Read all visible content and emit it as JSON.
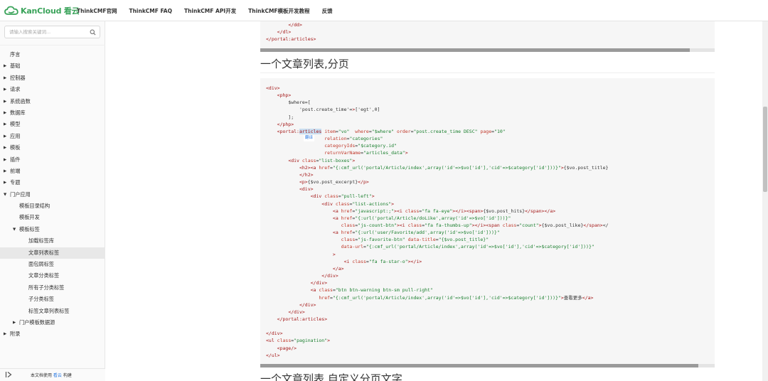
{
  "header": {
    "brand": "KanCloud 看云",
    "nav": [
      "ThinkCMF官网",
      "ThinkCMF FAQ",
      "ThinkCMF API开发",
      "ThinkCMF模板开发教程",
      "反馈"
    ]
  },
  "search": {
    "placeholder": "请输入搜索关键词..."
  },
  "toc": [
    {
      "label": "序言",
      "level": 0,
      "arrow": ""
    },
    {
      "label": "基础",
      "level": 0,
      "arrow": "right"
    },
    {
      "label": "控制器",
      "level": 0,
      "arrow": "right"
    },
    {
      "label": "请求",
      "level": 0,
      "arrow": "right"
    },
    {
      "label": "系统函数",
      "level": 0,
      "arrow": "right"
    },
    {
      "label": "数据库",
      "level": 0,
      "arrow": "right"
    },
    {
      "label": "模型",
      "level": 0,
      "arrow": "right"
    },
    {
      "label": "应用",
      "level": 0,
      "arrow": "right"
    },
    {
      "label": "模板",
      "level": 0,
      "arrow": "right"
    },
    {
      "label": "插件",
      "level": 0,
      "arrow": "right"
    },
    {
      "label": "前端",
      "level": 0,
      "arrow": "right"
    },
    {
      "label": "专题",
      "level": 0,
      "arrow": "right"
    },
    {
      "label": "门户应用",
      "level": 0,
      "arrow": "down"
    },
    {
      "label": "模板目录结构",
      "level": 1,
      "arrow": ""
    },
    {
      "label": "模板开发",
      "level": 1,
      "arrow": ""
    },
    {
      "label": "模板标签",
      "level": 1,
      "arrow": "down"
    },
    {
      "label": "加载标签库",
      "level": 2,
      "arrow": ""
    },
    {
      "label": "文章列表标签",
      "level": 2,
      "arrow": "",
      "active": true
    },
    {
      "label": "面包屑标签",
      "level": 2,
      "arrow": ""
    },
    {
      "label": "文章分类标签",
      "level": 2,
      "arrow": ""
    },
    {
      "label": "所有子分类标签",
      "level": 2,
      "arrow": ""
    },
    {
      "label": "子分类标签",
      "level": 2,
      "arrow": ""
    },
    {
      "label": "标签文章列表标签",
      "level": 2,
      "arrow": ""
    },
    {
      "label": "门户模板数据源",
      "level": 1,
      "arrow": "right"
    },
    {
      "label": "附录",
      "level": 0,
      "arrow": "right"
    }
  ],
  "footer": {
    "prefix": "本文档使用 ",
    "link": "看云",
    "suffix": " 构建"
  },
  "content": {
    "code_top": [
      "        </dd>",
      "    </dl>",
      "</portal:articles>"
    ],
    "heading1": "一个文章列表,分页",
    "selection_popup": "翻译",
    "code_main": [
      "<div>",
      "    <php>",
      "        $where=[",
      "            'post.create_time'=>['egt',0]",
      "        ];",
      "    </php>",
      "    <portal:articles item=\"vo\"  where=\"$where\" order=\"post.create_time DESC\" page=\"10\"",
      "                     relation=\"categories\"",
      "                     categoryIds=\"$category.id\"",
      "                     returnVarName=\"articles_data\">",
      "        <div class=\"list-boxes\">",
      "            <h2><a href=\"{:cmf_url('portal/Article/index',array('id'=>$vo['id'],'cid'=>$category['id']))}\">{$vo.post_title}",
      "            </h2>",
      "            <p>{$vo.post_excerpt}</p>",
      "            <div>",
      "                <div class=\"pull-left\">",
      "                    <div class=\"list-actions\">",
      "                        <a href=\"javascript:;\"><i class=\"fa fa-eye\"></i><span>{$vo.post_hits}</span></a>",
      "                        <a href=\"{:url('portal/Article/doLike',array('id'=>$vo['id']))}\"",
      "                           class=\"js-count-btn\"><i class=\"fa fa-thumbs-up\"></i><span class=\"count\">{$vo.post_like}</span></",
      "                        <a href=\"{:url('user/Favorite/add',array('id'=>$vo['id']))}\"",
      "                           class=\"js-favorite-btn\" data-title=\"{$vo.post_title}\"",
      "                           data-url=\"{:cmf_url('portal/Article/index',array('id'=>$vo['id'],'cid'=>$category['id']))}\"",
      "                        >",
      "                            <i class=\"fa fa-star-o\"></i>",
      "                        </a>",
      "                    </div>",
      "                </div>",
      "                <a class=\"btn btn-warning btn-sm pull-right\"",
      "                   href=\"{:cmf_url('portal/Article/index',array('id'=>$vo['id'],'cid'=>$category['id']))}\">查看更多</a>",
      "            </div>",
      "        </div>",
      "    </portal:articles>",
      "",
      "</div>",
      "<ul class=\"pagination\">",
      "    <page/>",
      "</ul>"
    ],
    "heading2": "一个文章列表,自定义分页文字"
  },
  "colors": {
    "brand": "#3aa35a",
    "link": "#2a7ae2",
    "tag": "#a31515",
    "attr": "#c0392b",
    "string": "#1a7f2e"
  }
}
